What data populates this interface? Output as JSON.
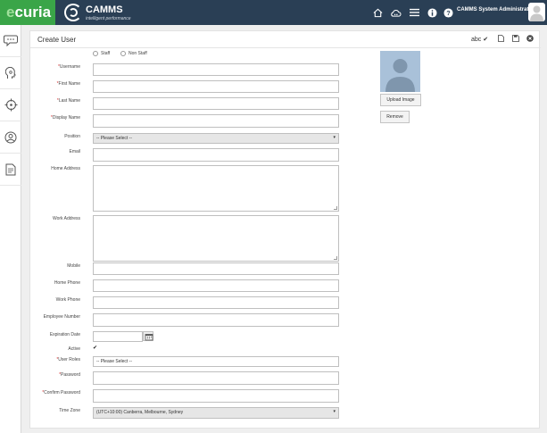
{
  "app": {
    "logo": "ecuria",
    "brand": "CAMMS",
    "brand_tagline": "intelligent performance",
    "user_name": "CAMMS System Administrator1"
  },
  "topbar_icons": [
    "home-icon",
    "cloud-icon",
    "menu-icon",
    "info-icon",
    "help-icon"
  ],
  "sidebar_icons": [
    "chat-icon",
    "head-icon",
    "target-icon",
    "user-icon",
    "report-icon"
  ],
  "page": {
    "title": "Create User",
    "spell_label": "abc"
  },
  "staff_type": {
    "options": [
      "Staff",
      "Non Staff"
    ]
  },
  "form": {
    "username": {
      "label": "Username",
      "required": true,
      "value": ""
    },
    "first_name": {
      "label": "First Name",
      "required": true,
      "value": ""
    },
    "last_name": {
      "label": "Last Name",
      "required": true,
      "value": ""
    },
    "display_name": {
      "label": "Display Name",
      "required": true,
      "value": ""
    },
    "position": {
      "label": "Position",
      "required": false,
      "value": "-- Please Select --"
    },
    "email": {
      "label": "Email",
      "required": false,
      "value": ""
    },
    "home_address": {
      "label": "Home Address",
      "required": false,
      "value": ""
    },
    "work_address": {
      "label": "Work Address",
      "required": false,
      "value": ""
    },
    "mobile": {
      "label": "Mobile",
      "required": false,
      "value": ""
    },
    "home_phone": {
      "label": "Home Phone",
      "required": false,
      "value": ""
    },
    "work_phone": {
      "label": "Work Phone",
      "required": false,
      "value": ""
    },
    "employee_number": {
      "label": "Employee Number",
      "required": false,
      "value": ""
    },
    "expiration_date": {
      "label": "Expiration Date",
      "required": false,
      "value": ""
    },
    "active": {
      "label": "Active",
      "checked": true
    },
    "user_roles": {
      "label": "User Roles",
      "required": true,
      "value": "-- Please Select --"
    },
    "password": {
      "label": "Password",
      "required": true,
      "value": ""
    },
    "confirm_password": {
      "label": "Confirm Password",
      "required": true,
      "value": ""
    },
    "time_zone": {
      "label": "Time Zone",
      "required": false,
      "value": "(UTC+10:00) Canberra, Melbourne, Sydney"
    }
  },
  "photo": {
    "upload_label": "Upload Image",
    "remove_label": "Remove"
  },
  "colors": {
    "topbar": "#2a3f55",
    "logo_bg": "#3aa548",
    "required": "#d32f2f"
  }
}
